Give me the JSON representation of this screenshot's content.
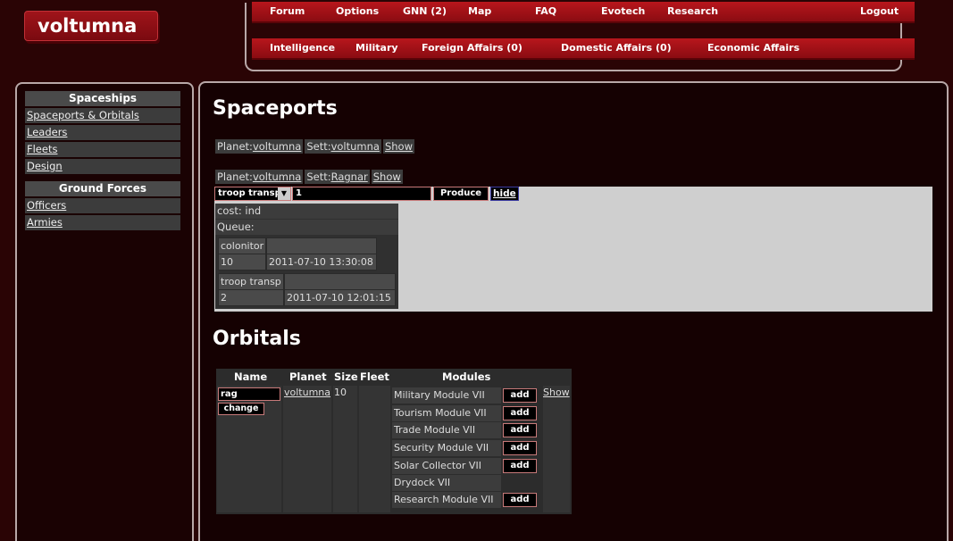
{
  "brand": {
    "logo_text": "voltumna"
  },
  "nav": {
    "row1": [
      "Forum",
      "Options",
      "GNN (2)",
      "Map",
      "FAQ",
      "Evotech",
      "Research",
      "Logout"
    ],
    "row2": [
      "Intelligence",
      "Military",
      "Foreign Affairs (0)",
      "Domestic Affairs (0)",
      "Economic Affairs"
    ]
  },
  "sidebar": {
    "spaceships": {
      "heading": "Spaceships",
      "items": [
        "Spaceports & Orbitals",
        "Leaders",
        "Fleets",
        "Design"
      ]
    },
    "ground": {
      "heading": "Ground Forces",
      "items": [
        "Officers",
        "Armies"
      ]
    }
  },
  "spaceports": {
    "title": "Spaceports",
    "entries": [
      {
        "planet_label": "Planet:",
        "planet": "voltumna",
        "sett_label": "Sett:",
        "sett": "voltumna",
        "action": "Show"
      },
      {
        "planet_label": "Planet:",
        "planet": "voltumna",
        "sett_label": "Sett:",
        "sett": "Ragnar",
        "action": "Show"
      }
    ],
    "production": {
      "selected_unit": "troop transp",
      "quantity": "1",
      "produce_label": "Produce",
      "hide_label": "hide",
      "cost": "cost: ind",
      "queue_label": "Queue:",
      "queue": [
        {
          "unit": "colonitor",
          "count": "10",
          "time": "2011-07-10 13:30:08"
        },
        {
          "unit": "troop transp",
          "count": "2",
          "time": "2011-07-10 12:01:15"
        }
      ]
    }
  },
  "orbitals": {
    "title": "Orbitals",
    "headers": {
      "name": "Name",
      "planet": "Planet",
      "size": "Size",
      "fleet": "Fleet",
      "modules": "Modules"
    },
    "row": {
      "name_value": "rag",
      "change_label": "change",
      "planet": "voltumna",
      "size": "10",
      "show_label": "Show",
      "add_label": "add",
      "modules": [
        {
          "name": "Military Module VII",
          "addable": true
        },
        {
          "name": "Tourism Module VII",
          "addable": true
        },
        {
          "name": "Trade Module VII",
          "addable": true
        },
        {
          "name": "Security Module VII",
          "addable": true
        },
        {
          "name": "Solar Collector VII",
          "addable": true
        },
        {
          "name": "Drydock VII",
          "addable": false
        },
        {
          "name": "Research Module VII",
          "addable": true
        }
      ]
    }
  }
}
